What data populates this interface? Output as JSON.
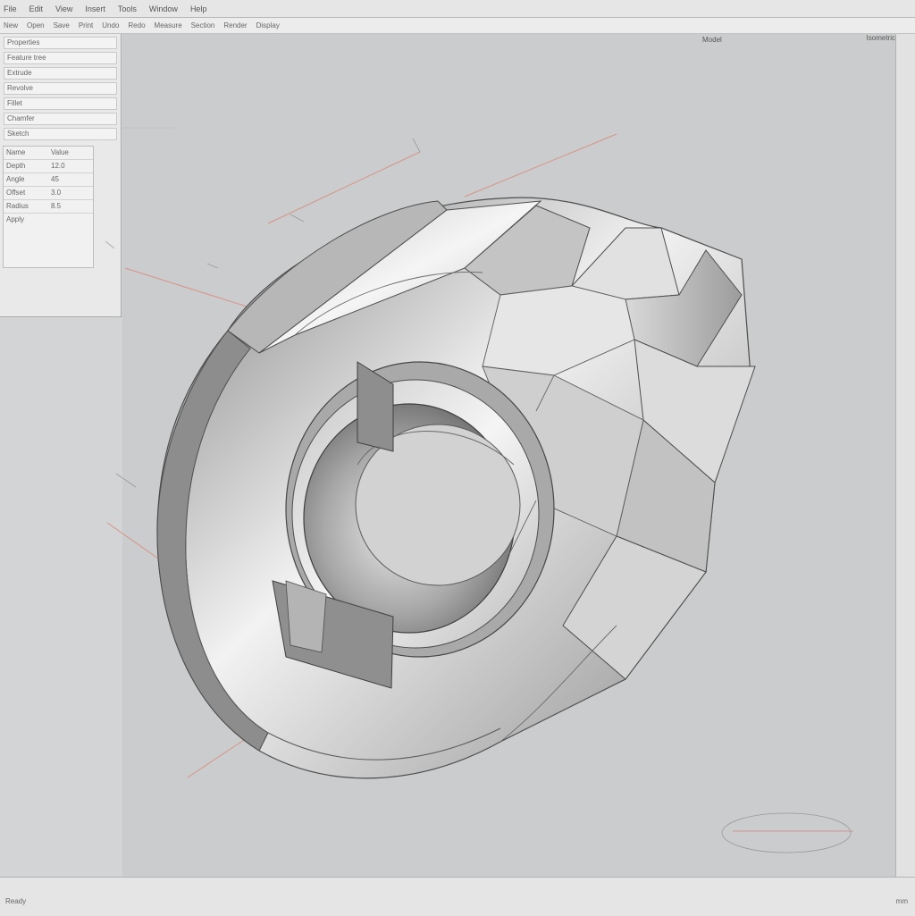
{
  "menubar": {
    "items": [
      "File",
      "Edit",
      "View",
      "Insert",
      "Tools",
      "Window",
      "Help"
    ]
  },
  "toolbar": {
    "items": [
      "New",
      "Open",
      "Save",
      "Print",
      "Undo",
      "Redo",
      "Measure",
      "Section",
      "Render",
      "Display"
    ]
  },
  "panel": {
    "rows": [
      "Properties",
      "Feature tree",
      "Extrude",
      "Revolve",
      "Fillet",
      "Chamfer",
      "Sketch"
    ],
    "table_header": [
      "Name",
      "Value"
    ],
    "table_rows": [
      [
        "Depth",
        "12.0"
      ],
      [
        "Angle",
        "45"
      ],
      [
        "Offset",
        "3.0"
      ],
      [
        "Radius",
        "8.5"
      ]
    ],
    "footer": "Apply"
  },
  "viewport": {
    "view_label": "Model",
    "tab_label": "Isometric"
  },
  "status": {
    "left_text": "Ready",
    "right_text": "mm"
  }
}
